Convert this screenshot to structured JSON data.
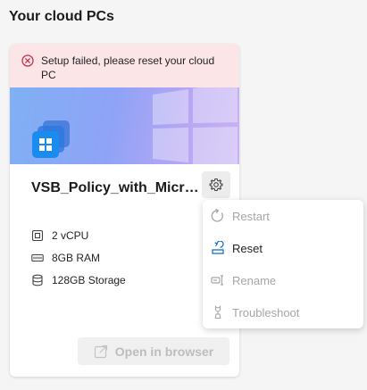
{
  "page": {
    "title": "Your cloud PCs"
  },
  "card": {
    "error_message": "Setup failed, please reset your cloud PC",
    "pc_name": "VSB_Policy_with_Microsoft",
    "specs": [
      {
        "icon": "cpu-icon",
        "label": "2 vCPU"
      },
      {
        "icon": "ram-icon",
        "label": "8GB RAM"
      },
      {
        "icon": "storage-icon",
        "label": "128GB Storage"
      }
    ],
    "open_button_label": "Open in browser"
  },
  "menu": {
    "items": [
      {
        "icon": "restart-icon",
        "label": "Restart",
        "enabled": false
      },
      {
        "icon": "reset-icon",
        "label": "Reset",
        "enabled": true
      },
      {
        "icon": "rename-icon",
        "label": "Rename",
        "enabled": false
      },
      {
        "icon": "troubleshoot-icon",
        "label": "Troubleshoot",
        "enabled": false
      }
    ]
  },
  "colors": {
    "error_bg": "#fbe5e7",
    "error_icon": "#c4314b",
    "accent": "#0f6cbd",
    "disabled_text": "#a6a6a6"
  }
}
